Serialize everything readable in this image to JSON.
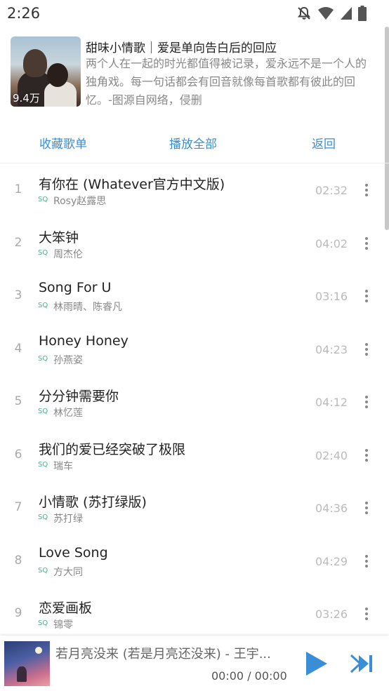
{
  "status_bar": {
    "time": "2:26",
    "icons": [
      "notifications-off-icon",
      "wifi-icon",
      "cellular-signal-icon",
      "battery-icon"
    ]
  },
  "playlist": {
    "title": "甜味小情歌｜爱是单向告白后的回应",
    "description": "两个人在一起的时光都值得被记录，爱永远不是一个人的独角戏。每一句话都会有回音就像每首歌都有彼此的回忆。-图源自网络，侵删",
    "play_count": "9.4万"
  },
  "actions": {
    "collect": "收藏歌单",
    "play_all": "播放全部",
    "back": "返回"
  },
  "colors": {
    "accent": "#3a8ed6",
    "sq_badge": "#3fb98a"
  },
  "songs": [
    {
      "index": "1",
      "title": "有你在 (Whatever官方中文版)",
      "quality": "SQ",
      "artist": "Rosy赵露思",
      "duration": "02:32"
    },
    {
      "index": "2",
      "title": "大笨钟",
      "quality": "SQ",
      "artist": "周杰伦",
      "duration": "04:02"
    },
    {
      "index": "3",
      "title": "Song For U",
      "quality": "SQ",
      "artist": "林雨晴、陈睿凡",
      "duration": "03:16"
    },
    {
      "index": "4",
      "title": "Honey Honey",
      "quality": "SQ",
      "artist": "孙燕姿",
      "duration": "04:23"
    },
    {
      "index": "5",
      "title": "分分钟需要你",
      "quality": "SQ",
      "artist": "林忆莲",
      "duration": "04:12"
    },
    {
      "index": "6",
      "title": "我们的爱已经突破了极限",
      "quality": "SQ",
      "artist": "瑞车",
      "duration": "02:40"
    },
    {
      "index": "7",
      "title": "小情歌 (苏打绿版)",
      "quality": "SQ",
      "artist": "苏打绿",
      "duration": "04:36"
    },
    {
      "index": "8",
      "title": "Love Song",
      "quality": "SQ",
      "artist": "方大同",
      "duration": "04:29"
    },
    {
      "index": "9",
      "title": "恋爱画板",
      "quality": "SQ",
      "artist": "锦零",
      "duration": "03:26"
    }
  ],
  "player": {
    "now_playing": "若月亮没来 (若是月亮还没来) - 王宇...",
    "time": "00:00 / 00:00",
    "play_icon": "play-icon",
    "next_icon": "skip-next-icon"
  }
}
